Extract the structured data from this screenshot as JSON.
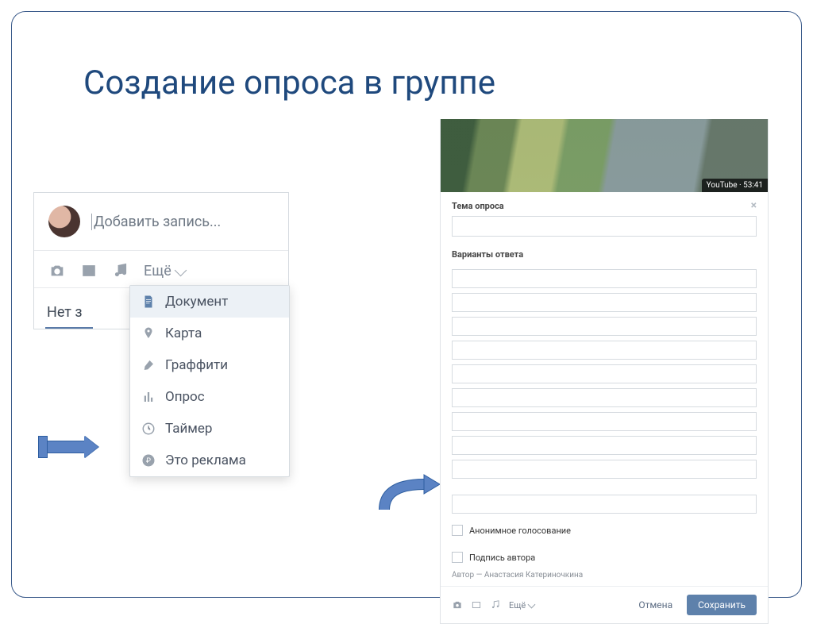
{
  "slide": {
    "title": "Создание опроса в группе"
  },
  "left": {
    "placeholder": "Добавить запись...",
    "more_label": "Ещё",
    "no_posts": "Нет з",
    "menu": {
      "doc": "Документ",
      "map": "Карта",
      "graffiti": "Граффити",
      "poll": "Опрос",
      "timer": "Таймер",
      "ads": "Это реклама"
    }
  },
  "right": {
    "youtube_badge": "YouTube · 53:41",
    "poll_topic_label": "Тема опроса",
    "options_label": "Варианты ответа",
    "anon_label": "Анонимное голосование",
    "signature_label": "Подпись автора",
    "author_line": "Автор — Анастасия Катериночкина",
    "more_label": "Ещё",
    "cancel": "Отмена",
    "save": "Сохранить"
  }
}
